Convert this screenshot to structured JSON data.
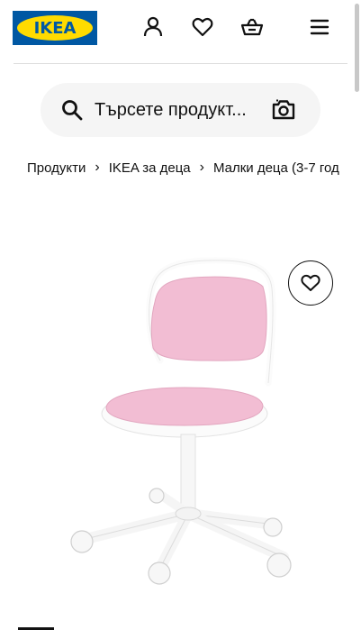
{
  "header": {
    "logo_text": "IKEA",
    "icons": [
      "profile-icon",
      "heart-icon",
      "basket-icon",
      "menu-icon"
    ]
  },
  "search": {
    "placeholder": "Търсете продукт...",
    "icon": "search-icon",
    "camera_icon": "camera-icon"
  },
  "breadcrumb": {
    "items": [
      "Продукти",
      "IKEA за деца",
      "Малки деца (3-7 год"
    ],
    "separator": "›"
  },
  "product": {
    "image": "pink-white-children-desk-chair",
    "favorite_icon": "heart-icon"
  },
  "colors": {
    "brand_blue": "#0058a3",
    "brand_yellow": "#ffdb00",
    "search_bg": "#f5f5f5",
    "chair_pink": "#f2bdd3",
    "chair_frame": "#ffffff"
  }
}
